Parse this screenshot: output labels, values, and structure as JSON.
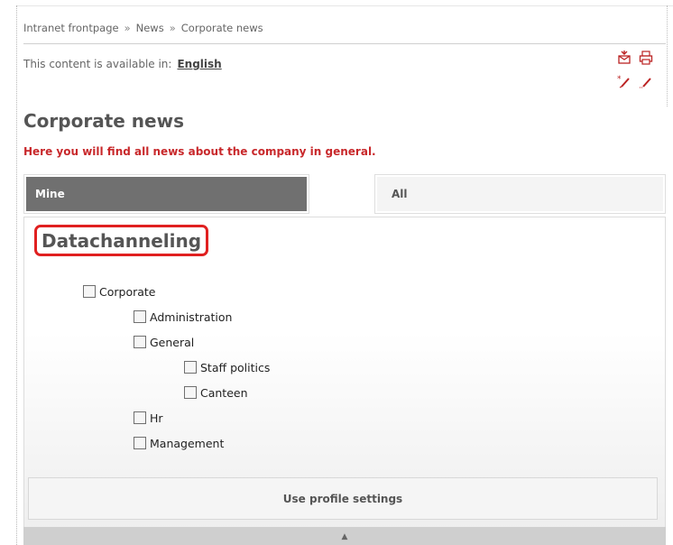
{
  "breadcrumb": {
    "items": [
      "Intranet frontpage",
      "News",
      "Corporate news"
    ],
    "separator": "»"
  },
  "availability": {
    "label": "This content is available in:",
    "language": "English"
  },
  "toolbar": {
    "icons": [
      "email-icon",
      "print-icon",
      "new-edit-icon",
      "edit-icon"
    ]
  },
  "page": {
    "title": "Corporate news",
    "intro": "Here you will find all news about the company in general."
  },
  "tabs": [
    {
      "label": "Mine",
      "active": true
    },
    {
      "label": "All",
      "active": false
    }
  ],
  "datachanneling": {
    "title": "Datachanneling",
    "tree": [
      {
        "label": "Corporate",
        "level": 0,
        "checked": false
      },
      {
        "label": "Administration",
        "level": 1,
        "checked": false
      },
      {
        "label": "General",
        "level": 1,
        "checked": false
      },
      {
        "label": "Staff politics",
        "level": 2,
        "checked": false
      },
      {
        "label": "Canteen",
        "level": 2,
        "checked": false
      },
      {
        "label": "Hr",
        "level": 1,
        "checked": false
      },
      {
        "label": "Management",
        "level": 1,
        "checked": false
      }
    ],
    "profile_button": "Use profile settings"
  },
  "colors": {
    "accent_red": "#c8282b",
    "highlight_red": "#e02020",
    "active_tab": "#707070"
  }
}
